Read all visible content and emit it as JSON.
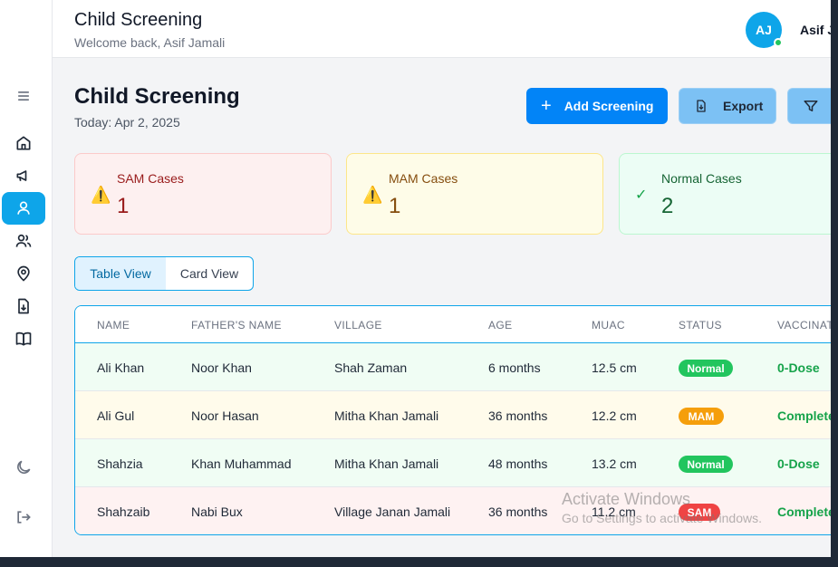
{
  "header": {
    "title": "Child Screening",
    "subtitle": "Welcome back, Asif Jamali",
    "avatar_initials": "AJ",
    "user_name": "Asif Jamali"
  },
  "sidebar": {
    "items": [
      {
        "name": "menu-icon"
      },
      {
        "name": "home-icon"
      },
      {
        "name": "megaphone-icon"
      },
      {
        "name": "user-icon",
        "active": true
      },
      {
        "name": "users-icon"
      },
      {
        "name": "map-pin-icon"
      },
      {
        "name": "download-file-icon"
      },
      {
        "name": "book-icon"
      },
      {
        "name": "moon-icon"
      },
      {
        "name": "logout-icon"
      }
    ]
  },
  "page": {
    "title": "Child Screening",
    "date": "Today: Apr 2, 2025"
  },
  "actions": {
    "add_label": "Add Screening",
    "export_label": "Export"
  },
  "stats": {
    "sam": {
      "label": "SAM Cases",
      "value": "1"
    },
    "mam": {
      "label": "MAM Cases",
      "value": "1"
    },
    "normal": {
      "label": "Normal Cases",
      "value": "2"
    }
  },
  "views": {
    "table": "Table View",
    "card": "Card View"
  },
  "table": {
    "headers": [
      "Name",
      "Father's Name",
      "Village",
      "Age",
      "MUAC",
      "Status",
      "Vaccinat"
    ],
    "rows": [
      {
        "name": "Ali Khan",
        "father": "Noor Khan",
        "village": "Shah Zaman",
        "age": "6 months",
        "muac": "12.5 cm",
        "status": "Normal",
        "vaccination": "0-Dose"
      },
      {
        "name": "Ali Gul",
        "father": "Noor Hasan",
        "village": "Mitha Khan Jamali",
        "age": "36 months",
        "muac": "12.2 cm",
        "status": "MAM",
        "vaccination": "Complete"
      },
      {
        "name": "Shahzia",
        "father": "Khan Muhammad",
        "village": "Mitha Khan Jamali",
        "age": "48 months",
        "muac": "13.2 cm",
        "status": "Normal",
        "vaccination": "0-Dose"
      },
      {
        "name": "Shahzaib",
        "father": "Nabi Bux",
        "village": "Village Janan Jamali",
        "age": "36 months",
        "muac": "11.2 cm",
        "status": "SAM",
        "vaccination": "Complete"
      }
    ]
  },
  "colors": {
    "accent": "#0ea5e9",
    "normal_badge": "#22c55e",
    "mam_badge": "#f59e0b",
    "sam_badge": "#ef4444",
    "row_normal": "#f0fdf4",
    "row_mam": "#fffbeb",
    "row_sam": "#fef2f2"
  },
  "watermark": {
    "line1": "Activate Windows",
    "line2": "Go to Settings to activate Windows."
  }
}
